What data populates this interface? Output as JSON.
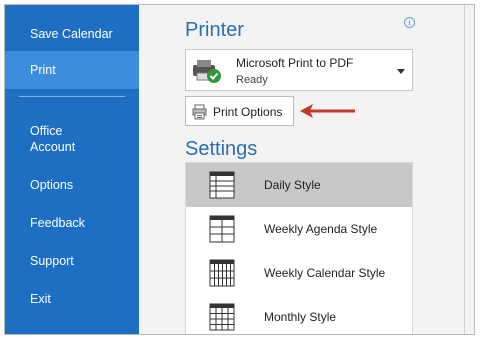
{
  "sidebar": {
    "items": [
      {
        "label": "Save Calendar"
      },
      {
        "label": "Print"
      },
      {
        "label": "Office\nAccount"
      },
      {
        "label": "Options"
      },
      {
        "label": "Feedback"
      },
      {
        "label": "Support"
      },
      {
        "label": "Exit"
      }
    ],
    "office_line1": "Office",
    "office_line2": "Account",
    "active_item": "Print"
  },
  "printer": {
    "heading": "Printer",
    "name": "Microsoft Print to PDF",
    "status": "Ready",
    "options_label": "Print Options"
  },
  "settings": {
    "heading": "Settings",
    "styles": [
      {
        "label": "Daily Style",
        "selected": true
      },
      {
        "label": "Weekly Agenda Style",
        "selected": false
      },
      {
        "label": "Weekly Calendar Style",
        "selected": false
      },
      {
        "label": "Monthly Style",
        "selected": false
      }
    ]
  },
  "colors": {
    "sidebar_bg": "#1e6ec4",
    "sidebar_active": "#3d8ddf",
    "heading": "#2b6eb8",
    "annotation_arrow": "#c0392b",
    "selected_row": "#c8c8c8"
  }
}
